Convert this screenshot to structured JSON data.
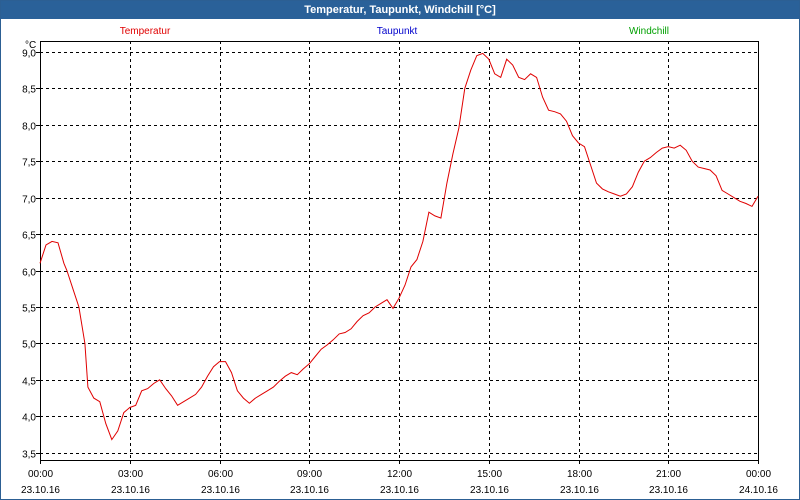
{
  "window": {
    "title": "Temperatur, Taupunkt, Windchill [°C]"
  },
  "chart_data": {
    "type": "line",
    "title": "Temperatur, Taupunkt, Windchill [°C]",
    "ylabel": "°C",
    "ylim": [
      3.4,
      9.15
    ],
    "yticks": [
      "3,5",
      "4,0",
      "4,5",
      "5,0",
      "5,5",
      "6,0",
      "6,5",
      "7,0",
      "7,5",
      "8,0",
      "8,5",
      "9,0"
    ],
    "ytick_values": [
      3.5,
      4.0,
      4.5,
      5.0,
      5.5,
      6.0,
      6.5,
      7.0,
      7.5,
      8.0,
      8.5,
      9.0
    ],
    "xlim_hours": [
      0,
      24
    ],
    "xticks": [
      {
        "time": "00:00",
        "date": "23.10.16"
      },
      {
        "time": "03:00",
        "date": "23.10.16"
      },
      {
        "time": "06:00",
        "date": "23.10.16"
      },
      {
        "time": "09:00",
        "date": "23.10.16"
      },
      {
        "time": "12:00",
        "date": "23.10.16"
      },
      {
        "time": "15:00",
        "date": "23.10.16"
      },
      {
        "time": "18:00",
        "date": "23.10.16"
      },
      {
        "time": "21:00",
        "date": "23.10.16"
      },
      {
        "time": "00:00",
        "date": "24.10.16"
      }
    ],
    "grid": true,
    "legend": [
      {
        "name": "Temperatur",
        "color": "#e00000"
      },
      {
        "name": "Taupunkt",
        "color": "#0000cc"
      },
      {
        "name": "Windchill",
        "color": "#00a000"
      }
    ],
    "series": [
      {
        "name": "Temperatur",
        "color": "#e00000",
        "x_hours": [
          0.0,
          0.2,
          0.4,
          0.6,
          0.8,
          0.9,
          1.1,
          1.3,
          1.5,
          1.6,
          1.8,
          2.0,
          2.2,
          2.4,
          2.6,
          2.8,
          3.0,
          3.2,
          3.4,
          3.6,
          3.8,
          4.0,
          4.2,
          4.4,
          4.6,
          4.8,
          5.0,
          5.2,
          5.4,
          5.6,
          5.8,
          6.0,
          6.2,
          6.4,
          6.6,
          6.8,
          7.0,
          7.2,
          7.4,
          7.6,
          7.8,
          8.0,
          8.2,
          8.4,
          8.6,
          8.8,
          9.0,
          9.2,
          9.4,
          9.6,
          9.8,
          10.0,
          10.2,
          10.4,
          10.6,
          10.8,
          11.0,
          11.2,
          11.4,
          11.6,
          11.8,
          12.0,
          12.2,
          12.4,
          12.6,
          12.8,
          13.0,
          13.2,
          13.4,
          13.6,
          13.8,
          14.0,
          14.2,
          14.4,
          14.6,
          14.8,
          15.0,
          15.2,
          15.4,
          15.6,
          15.8,
          16.0,
          16.2,
          16.4,
          16.6,
          16.8,
          17.0,
          17.2,
          17.4,
          17.6,
          17.8,
          18.0,
          18.2,
          18.4,
          18.6,
          18.8,
          19.0,
          19.2,
          19.4,
          19.6,
          19.8,
          20.0,
          20.2,
          20.4,
          20.6,
          20.8,
          21.0,
          21.2,
          21.4,
          21.6,
          21.8,
          22.0,
          22.2,
          22.4,
          22.6,
          22.8,
          23.0,
          23.2,
          23.4,
          23.6,
          23.8,
          24.0
        ],
        "values": [
          6.1,
          6.35,
          6.4,
          6.38,
          6.1,
          6.0,
          5.75,
          5.5,
          5.0,
          4.4,
          4.25,
          4.2,
          3.9,
          3.68,
          3.8,
          4.05,
          4.12,
          4.15,
          4.35,
          4.38,
          4.45,
          4.5,
          4.38,
          4.28,
          4.15,
          4.2,
          4.25,
          4.3,
          4.4,
          4.55,
          4.68,
          4.75,
          4.75,
          4.6,
          4.35,
          4.25,
          4.18,
          4.25,
          4.3,
          4.35,
          4.4,
          4.48,
          4.55,
          4.6,
          4.57,
          4.65,
          4.72,
          4.82,
          4.92,
          4.98,
          5.05,
          5.13,
          5.15,
          5.2,
          5.3,
          5.38,
          5.42,
          5.5,
          5.55,
          5.6,
          5.48,
          5.62,
          5.8,
          6.05,
          6.15,
          6.4,
          6.8,
          6.75,
          6.72,
          7.2,
          7.6,
          7.95,
          8.5,
          8.75,
          8.95,
          8.98,
          8.9,
          8.7,
          8.65,
          8.9,
          8.82,
          8.65,
          8.62,
          8.7,
          8.65,
          8.38,
          8.2,
          8.18,
          8.15,
          8.05,
          7.85,
          7.75,
          7.7,
          7.45,
          7.2,
          7.12,
          7.08,
          7.05,
          7.02,
          7.05,
          7.15,
          7.35,
          7.5,
          7.55,
          7.62,
          7.68,
          7.7,
          7.68,
          7.72,
          7.65,
          7.5,
          7.42,
          7.4,
          7.38,
          7.3,
          7.1,
          7.05,
          7.0,
          6.95,
          6.92,
          6.88,
          7.02
        ]
      }
    ]
  }
}
